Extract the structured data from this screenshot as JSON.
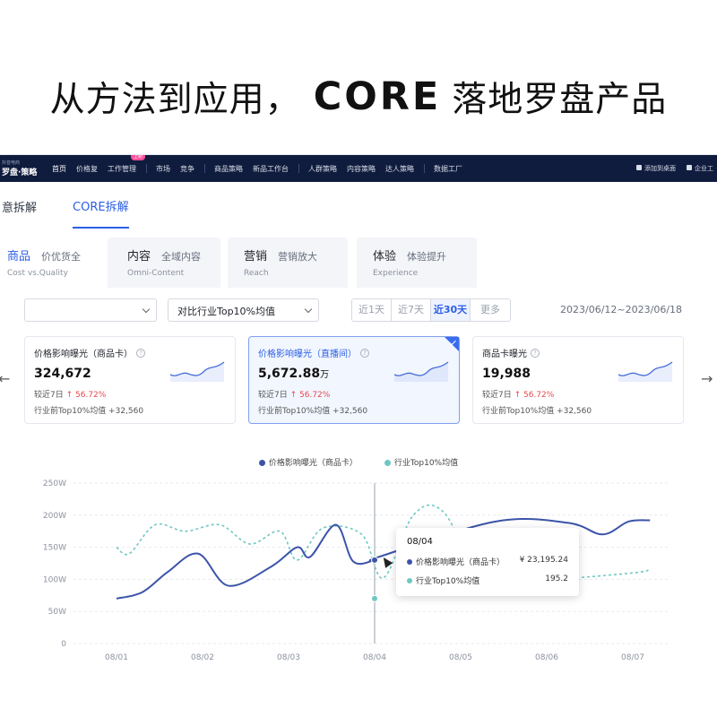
{
  "headline": {
    "pre": "从方法到应用，",
    "logo": "CORE",
    "post": "落地罗盘产品"
  },
  "topnav": {
    "brand_top": "抖音电商",
    "brand": "罗盘·策略",
    "items": [
      "首页",
      "价格复",
      "工作管理",
      "市场",
      "竞争",
      "商品策略",
      "新品工作台",
      "人群策略",
      "内容策略",
      "达人策略",
      "数据工厂"
    ],
    "badge": "上新",
    "right": [
      "添加到桌面",
      "企业工"
    ]
  },
  "subtabs": [
    "意拆解",
    "CORE拆解"
  ],
  "cattabs": [
    {
      "main": "商品",
      "sub": "价优货全",
      "en": "Cost vs.Quality"
    },
    {
      "main": "内容",
      "sub": "全域内容",
      "en": "Omni-Content"
    },
    {
      "main": "营销",
      "sub": "营销放大",
      "en": "Reach"
    },
    {
      "main": "体验",
      "sub": "体验提升",
      "en": "Experience"
    }
  ],
  "filters": {
    "select1": "",
    "select2": "对比行业Top10%均值",
    "ranges": [
      "近1天",
      "近7天",
      "近30天",
      "更多"
    ],
    "selected_range": "近30天",
    "daterange": "2023/06/12~2023/06/18"
  },
  "cards": [
    {
      "title": "价格影响曝光（商品卡）",
      "value": "324,672",
      "unit": "",
      "delta_label": "较近7日",
      "delta": "↑ 56.72%",
      "bench": "行业前Top10%均值  +32,560"
    },
    {
      "title": "价格影响曝光（直播间）",
      "value": "5,672.88",
      "unit": "万",
      "delta_label": "较近7日",
      "delta": "↑ 56.72%",
      "bench": "行业前Top10%均值  +32,560"
    },
    {
      "title": "商品卡曝光",
      "value": "19,988",
      "unit": "",
      "delta_label": "较近7日",
      "delta": "↑ 56.72%",
      "bench": "行业前Top10%均值  +32,560"
    }
  ],
  "colors": {
    "accent": "#2c5fe6",
    "series1": "#3b54a8",
    "series2": "#6fc7c3",
    "up": "#e8484d",
    "nav": "#101c3d"
  },
  "tooltip": {
    "date": "08/04",
    "rows": [
      {
        "name": "价格影响曝光（商品卡）",
        "value": "¥ 23,195.24"
      },
      {
        "name": "行业Top10%均值",
        "value": "195.2"
      }
    ]
  },
  "chart_data": {
    "type": "line",
    "x": [
      "08/01",
      "08/02",
      "08/03",
      "08/04",
      "08/05",
      "08/06",
      "08/07"
    ],
    "yticks": [
      "0",
      "50W",
      "100W",
      "150W",
      "200W",
      "250W"
    ],
    "ylim": [
      0,
      250
    ],
    "grid": true,
    "legend_position": "top-center",
    "series": [
      {
        "name": "价格影响曝光（商品卡）",
        "points": [
          [
            0.0,
            70
          ],
          [
            0.3,
            80
          ],
          [
            0.6,
            112
          ],
          [
            0.95,
            140
          ],
          [
            1.3,
            90
          ],
          [
            1.8,
            120
          ],
          [
            2.1,
            150
          ],
          [
            2.25,
            135
          ],
          [
            2.55,
            185
          ],
          [
            2.75,
            128
          ],
          [
            3.0,
            130
          ],
          [
            3.05,
            135
          ],
          [
            4.4,
            190
          ],
          [
            5.25,
            188
          ],
          [
            5.65,
            170
          ],
          [
            5.95,
            190
          ],
          [
            6.2,
            192
          ]
        ]
      },
      {
        "name": "行业Top10%均值",
        "points": [
          [
            0.0,
            150
          ],
          [
            0.15,
            140
          ],
          [
            0.45,
            185
          ],
          [
            0.8,
            175
          ],
          [
            1.2,
            185
          ],
          [
            1.55,
            155
          ],
          [
            1.9,
            175
          ],
          [
            2.1,
            130
          ],
          [
            2.4,
            180
          ],
          [
            2.85,
            170
          ],
          [
            3.1,
            102
          ],
          [
            3.45,
            200
          ],
          [
            3.8,
            205
          ],
          [
            4.3,
            95
          ],
          [
            5.1,
            100
          ],
          [
            6.0,
            110
          ],
          [
            6.2,
            115
          ]
        ]
      }
    ]
  }
}
